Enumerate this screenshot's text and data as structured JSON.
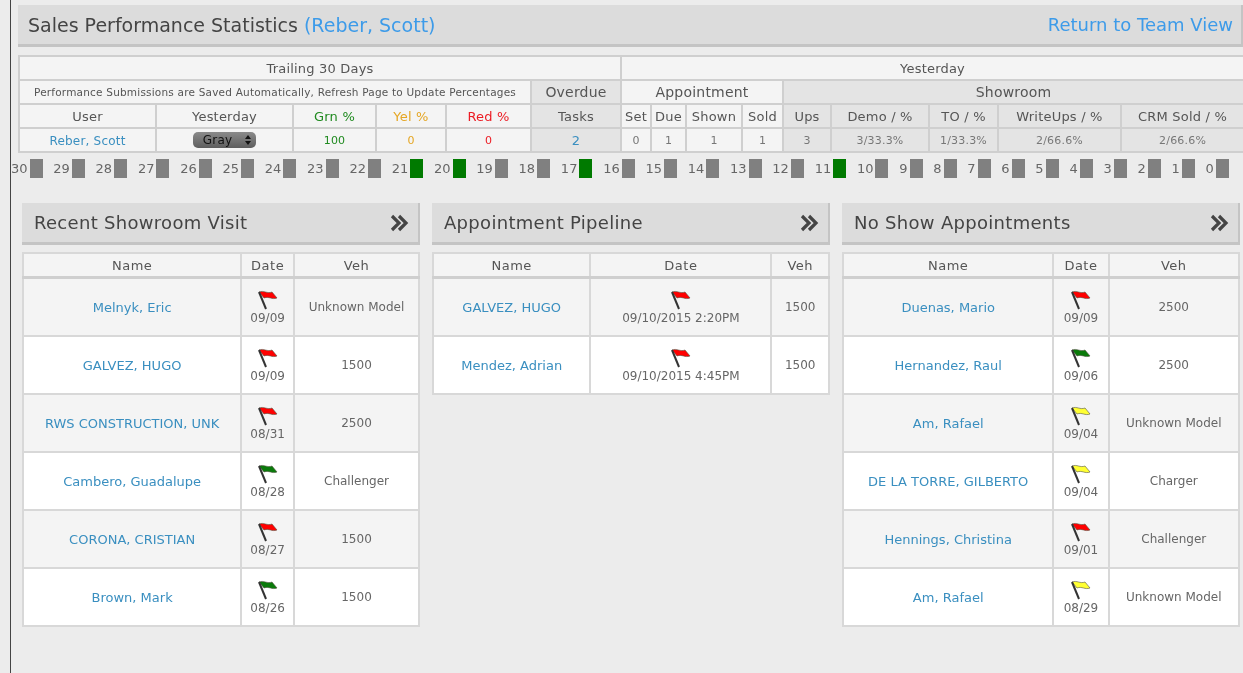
{
  "header": {
    "title": "Sales Performance Statistics",
    "user": "(Reber, Scott)",
    "return_link": "Return to Team View"
  },
  "stats": {
    "trailing_group": "Trailing 30 Days",
    "yesterday_group": "Yesterday",
    "note": "Performance Submissions are Saved Automatically, Refresh Page to Update Percentages",
    "overdue": "Overdue",
    "appointment": "Appointment",
    "showroom": "Showroom",
    "columns": [
      {
        "label": "User"
      },
      {
        "label": "Yesterday"
      },
      {
        "label": "Grn %",
        "color": "#1f8a1f"
      },
      {
        "label": "Yel %",
        "color": "#e5a623"
      },
      {
        "label": "Red %",
        "color": "#ec1c24"
      },
      {
        "label": "Tasks"
      },
      {
        "label": "Set"
      },
      {
        "label": "Due"
      },
      {
        "label": "Shown"
      },
      {
        "label": "Sold"
      },
      {
        "label": "Ups"
      },
      {
        "label": "Demo / %"
      },
      {
        "label": "TO / %"
      },
      {
        "label": "WriteUps / %"
      },
      {
        "label": "CRM Sold / %"
      }
    ],
    "row": {
      "user": "Reber, Scott",
      "yesterday_select": "Gray",
      "cells": [
        "100",
        "0",
        "0",
        "2",
        "0",
        "1",
        "1",
        "1",
        "3",
        "3/33.3%",
        "1/33.3%",
        "2/66.6%",
        "2/66.6%"
      ]
    }
  },
  "days": [
    {
      "label": "30",
      "color": "#808080"
    },
    {
      "label": "29",
      "color": "#808080"
    },
    {
      "label": "28",
      "color": "#808080"
    },
    {
      "label": "27",
      "color": "#808080"
    },
    {
      "label": "26",
      "color": "#808080"
    },
    {
      "label": "25",
      "color": "#808080"
    },
    {
      "label": "24",
      "color": "#808080"
    },
    {
      "label": "23",
      "color": "#808080"
    },
    {
      "label": "22",
      "color": "#808080"
    },
    {
      "label": "21",
      "color": "#007a00"
    },
    {
      "label": "20",
      "color": "#007a00"
    },
    {
      "label": "19",
      "color": "#808080"
    },
    {
      "label": "18",
      "color": "#808080"
    },
    {
      "label": "17",
      "color": "#007a00"
    },
    {
      "label": "16",
      "color": "#808080"
    },
    {
      "label": "15",
      "color": "#808080"
    },
    {
      "label": "14",
      "color": "#808080"
    },
    {
      "label": "13",
      "color": "#808080"
    },
    {
      "label": "12",
      "color": "#808080"
    },
    {
      "label": "11",
      "color": "#007a00"
    },
    {
      "label": "10",
      "color": "#808080"
    },
    {
      "label": "9",
      "color": "#808080"
    },
    {
      "label": "8",
      "color": "#808080"
    },
    {
      "label": "7",
      "color": "#808080"
    },
    {
      "label": "6",
      "color": "#808080"
    },
    {
      "label": "5",
      "color": "#808080"
    },
    {
      "label": "4",
      "color": "#808080"
    },
    {
      "label": "3",
      "color": "#808080"
    },
    {
      "label": "2",
      "color": "#808080"
    },
    {
      "label": "1",
      "color": "#808080"
    },
    {
      "label": "0",
      "color": "#808080"
    }
  ],
  "panels": [
    {
      "title": "Recent Showroom Visit",
      "columns": [
        "Name",
        "Date",
        "Veh"
      ],
      "rows": [
        {
          "name": "Melnyk, Eric",
          "color": "#ff0000",
          "date": "09/09",
          "vehicle": "Unknown Model"
        },
        {
          "name": "GALVEZ, HUGO",
          "color": "#ff0000",
          "date": "09/09",
          "vehicle": "1500"
        },
        {
          "name": "RWS CONSTRUCTION, UNK",
          "color": "#ff0000",
          "date": "08/31",
          "vehicle": "2500"
        },
        {
          "name": "Cambero, Guadalupe",
          "color": "#0a7a0a",
          "date": "08/28",
          "vehicle": "Challenger"
        },
        {
          "name": "CORONA, CRISTIAN",
          "color": "#ff0000",
          "date": "08/27",
          "vehicle": "1500"
        },
        {
          "name": "Brown, Mark",
          "color": "#0a7a0a",
          "date": "08/26",
          "vehicle": "1500"
        }
      ]
    },
    {
      "title": "Appointment Pipeline",
      "columns": [
        "Name",
        "Date",
        "Veh"
      ],
      "rows": [
        {
          "name": "GALVEZ, HUGO",
          "color": "#ff0000",
          "date": "09/10/2015 2:20PM",
          "vehicle": "1500"
        },
        {
          "name": "Mendez, Adrian",
          "color": "#ff0000",
          "date": "09/10/2015 4:45PM",
          "vehicle": "1500"
        }
      ]
    },
    {
      "title": "No Show Appointments",
      "columns": [
        "Name",
        "Date",
        "Veh"
      ],
      "rows": [
        {
          "name": "Duenas, Mario",
          "color": "#ff0000",
          "date": "09/09",
          "vehicle": "2500"
        },
        {
          "name": "Hernandez, Raul",
          "color": "#0a7a0a",
          "date": "09/06",
          "vehicle": "2500"
        },
        {
          "name": "Am, Rafael",
          "color": "#ffff33",
          "date": "09/04",
          "vehicle": "Unknown Model"
        },
        {
          "name": "DE LA TORRE, GILBERTO",
          "color": "#ffff33",
          "date": "09/04",
          "vehicle": "Charger"
        },
        {
          "name": "Hennings, Christina",
          "color": "#ff0000",
          "date": "09/01",
          "vehicle": "Challenger"
        },
        {
          "name": "Am, Rafael",
          "color": "#ffff33",
          "date": "08/29",
          "vehicle": "Unknown Model"
        }
      ]
    }
  ]
}
